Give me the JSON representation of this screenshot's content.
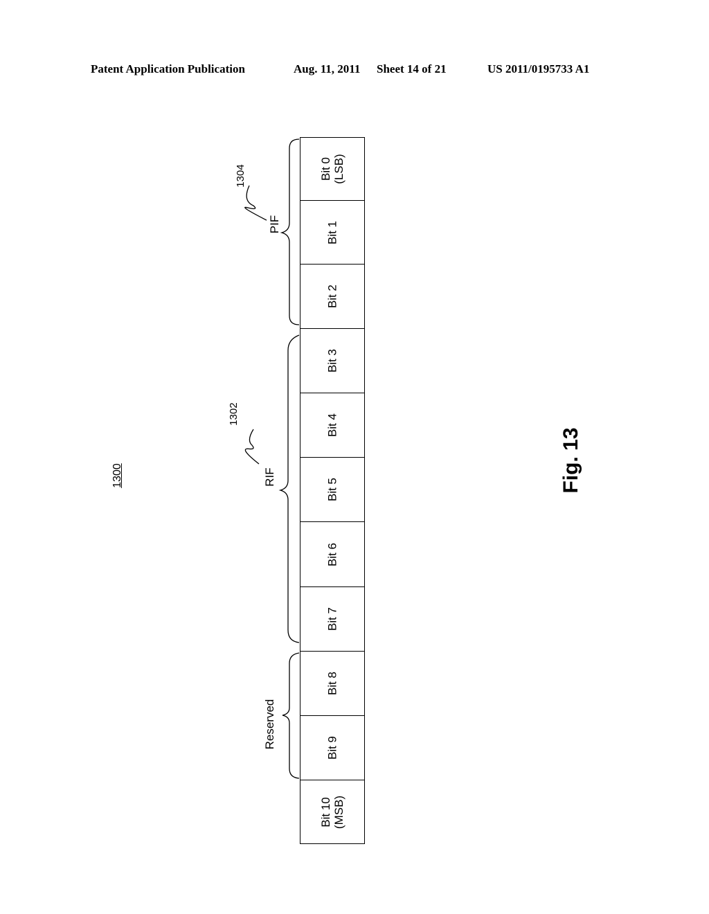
{
  "header": {
    "publication": "Patent Application Publication",
    "date": "Aug. 11, 2011",
    "sheet": "Sheet 14 of 21",
    "number": "US 2011/0195733 A1"
  },
  "figure": {
    "reference": "1300",
    "caption": "Fig. 13"
  },
  "register": {
    "cells": [
      {
        "line1": "Bit 0",
        "line2": "(LSB)"
      },
      {
        "line1": "Bit 1",
        "line2": ""
      },
      {
        "line1": "Bit 2",
        "line2": ""
      },
      {
        "line1": "Bit 3",
        "line2": ""
      },
      {
        "line1": "Bit 4",
        "line2": ""
      },
      {
        "line1": "Bit 5",
        "line2": ""
      },
      {
        "line1": "Bit 6",
        "line2": ""
      },
      {
        "line1": "Bit 7",
        "line2": ""
      },
      {
        "line1": "Bit 8",
        "line2": ""
      },
      {
        "line1": "Bit 9",
        "line2": ""
      },
      {
        "line1": "Bit 10",
        "line2": "(MSB)"
      }
    ]
  },
  "groups": [
    {
      "label": "PIF",
      "ref": "1304",
      "bits": "0-2"
    },
    {
      "label": "RIF",
      "ref": "1302",
      "bits": "3-7"
    },
    {
      "label": "Reserved",
      "ref": "",
      "bits": "8-9"
    }
  ]
}
